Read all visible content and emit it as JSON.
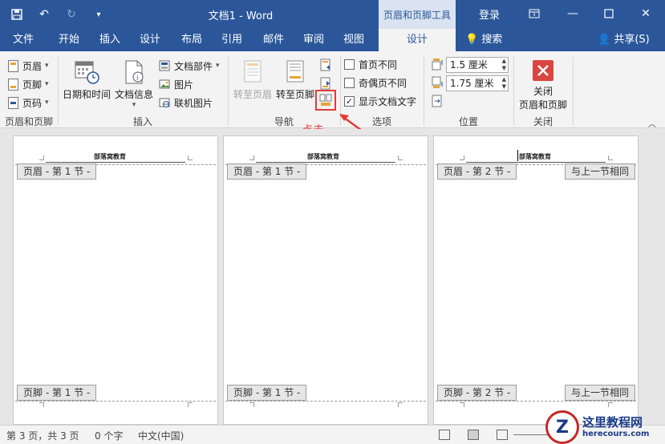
{
  "titlebar": {
    "doc_title": "文档1 - Word",
    "context_tab": "页眉和页脚工具",
    "login": "登录",
    "icons": [
      "save-icon",
      "undo-icon",
      "redo-icon",
      "customize-qat-icon",
      "ribbon-display-icon",
      "minimize-icon",
      "maximize-icon",
      "close-icon"
    ]
  },
  "tabs": {
    "items": [
      "文件",
      "开始",
      "插入",
      "设计",
      "布局",
      "引用",
      "邮件",
      "审阅",
      "视图",
      "设计"
    ],
    "active_index": 9,
    "tell_me": "搜索",
    "share": "共享(S)"
  },
  "ribbon": {
    "hf_group": {
      "header": "页眉",
      "footer": "页脚",
      "page_number": "页码",
      "label": "页眉和页脚"
    },
    "insert_group": {
      "datetime": "日期和时间",
      "docinfo": "文档信息",
      "quickparts": "文档部件",
      "pictures": "图片",
      "online_pictures": "联机图片",
      "label": "插入"
    },
    "nav_group": {
      "goto_header": "转至页眉",
      "goto_footer": "转至页脚",
      "label": "导航"
    },
    "options_group": {
      "first_page": "首页不同",
      "odd_even": "奇偶页不同",
      "show_doc_text": "显示文档文字",
      "first_checked": false,
      "odd_even_checked": false,
      "show_doc_checked": true,
      "label": "选项"
    },
    "position_group": {
      "header_from_top": "1.5 厘米",
      "footer_from_bottom": "1.75 厘米",
      "label": "位置"
    },
    "close_group": {
      "close_line1": "关闭",
      "close_line2": "页眉和页脚",
      "label": "关闭"
    }
  },
  "annotation": {
    "text": "点击",
    "color": "#e53935"
  },
  "pages": [
    {
      "header_text": "部落窝教育",
      "header_tag": "页眉 - 第 1 节 -",
      "footer_tag": "页脚 - 第 1 节 -",
      "same_as_prev": ""
    },
    {
      "header_text": "部落窝教育",
      "header_tag": "页眉 - 第 1 节 -",
      "footer_tag": "页脚 - 第 1 节 -",
      "same_as_prev": ""
    },
    {
      "header_text": "部落窝教育",
      "header_tag": "页眉 - 第 2 节 -",
      "footer_tag": "页脚 - 第 2 节 -",
      "same_as_prev": "与上一节相同"
    }
  ],
  "status": {
    "page": "第 3 页，共 3 页",
    "words": "0 个字",
    "lang": "中文(中国)"
  },
  "watermark": {
    "name": "这里教程网",
    "url": "herecours.com"
  },
  "colors": {
    "brand": "#2b579a",
    "ribbon_bg": "#f3f3f3",
    "highlight": "#e53935"
  }
}
